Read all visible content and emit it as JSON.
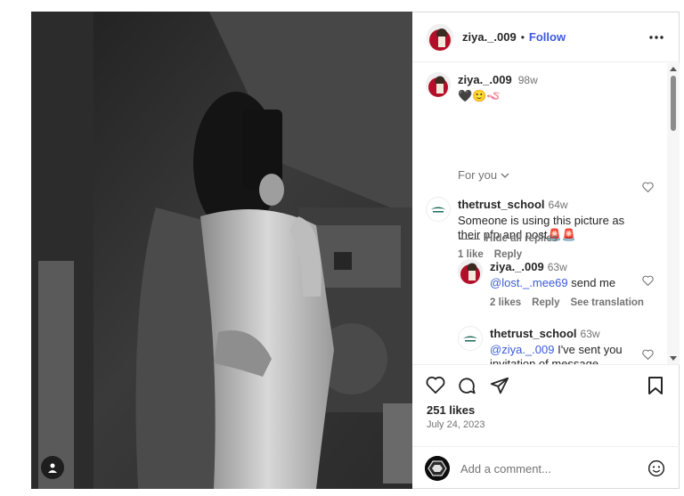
{
  "post": {
    "author": "ziya._.009",
    "follow_label": "Follow",
    "separator": "•",
    "caption_time": "98w",
    "caption_emojis": "🖤🙂🪱",
    "sort_label": "For you"
  },
  "comments": [
    {
      "user": "thetrust_school",
      "time": "64w",
      "text": "Someone is using this picture as their pfp and post🚨🚨",
      "likes": "1 like",
      "reply_label": "Reply"
    }
  ],
  "hide_replies_label": "Hide all replies",
  "replies": [
    {
      "user": "ziya._.009",
      "time": "63w",
      "mention": "@lost._.mee69",
      "text": " send me",
      "likes": "2 likes",
      "reply_label": "Reply",
      "translate_label": "See translation"
    },
    {
      "user": "thetrust_school",
      "time": "63w",
      "mention": "@ziya._.009",
      "text": " I've sent you invitation of message."
    }
  ],
  "footer": {
    "likes": "251 likes",
    "date": "July 24, 2023",
    "comment_placeholder": "Add a comment..."
  },
  "icons": {
    "like": "heart-icon",
    "comment": "comment-icon",
    "share": "send-icon",
    "save": "bookmark-icon",
    "more": "more-icon",
    "emoji": "emoji-icon",
    "user_tag": "user-tag-icon"
  },
  "colors": {
    "link": "#3b5bdb",
    "muted": "#737373",
    "text": "#262626"
  }
}
